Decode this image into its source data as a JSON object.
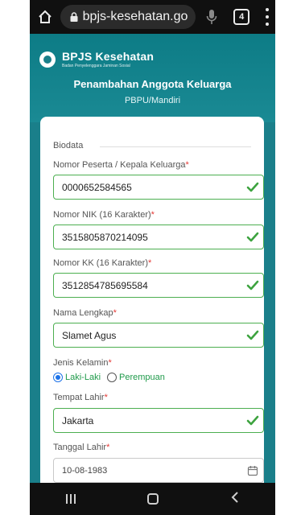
{
  "browser": {
    "url": "bpjs-kesehatan.go.id",
    "tab_count": "4",
    "icons": [
      "home-icon",
      "lock-icon",
      "mic-icon",
      "tabs-icon",
      "menu-icon"
    ]
  },
  "header": {
    "logo_title": "BPJS Kesehatan",
    "logo_subtitle": "Badan Penyelenggara Jaminan Sosial",
    "title": "Penambahan Anggota Keluarga",
    "subtitle": "PBPU/Mandiri"
  },
  "form": {
    "section": "Biodata",
    "fields": [
      {
        "label": "Nomor Peserta / Kepala Keluarga",
        "value": "0000652584565"
      },
      {
        "label": "Nomor NIK (16 Karakter)",
        "value": "3515805870214095"
      },
      {
        "label": "Nomor KK (16 Karakter)",
        "value": "3512854785695584"
      },
      {
        "label": "Nama Lengkap",
        "value": "Slamet Agus"
      }
    ],
    "gender": {
      "label": "Jenis Kelamin",
      "options": [
        "Laki-Laki",
        "Perempuan"
      ],
      "selected": "Laki-Laki"
    },
    "birthplace": {
      "label": "Tempat Lahir",
      "value": "Jakarta"
    },
    "birthdate": {
      "label": "Tanggal Lahir",
      "value": "10-08-1983"
    },
    "required_mark": "*"
  },
  "colors": {
    "brand": "#1a7f8a",
    "valid": "#4caf50",
    "required": "#e53935",
    "radio_selected": "#1e73e8"
  }
}
